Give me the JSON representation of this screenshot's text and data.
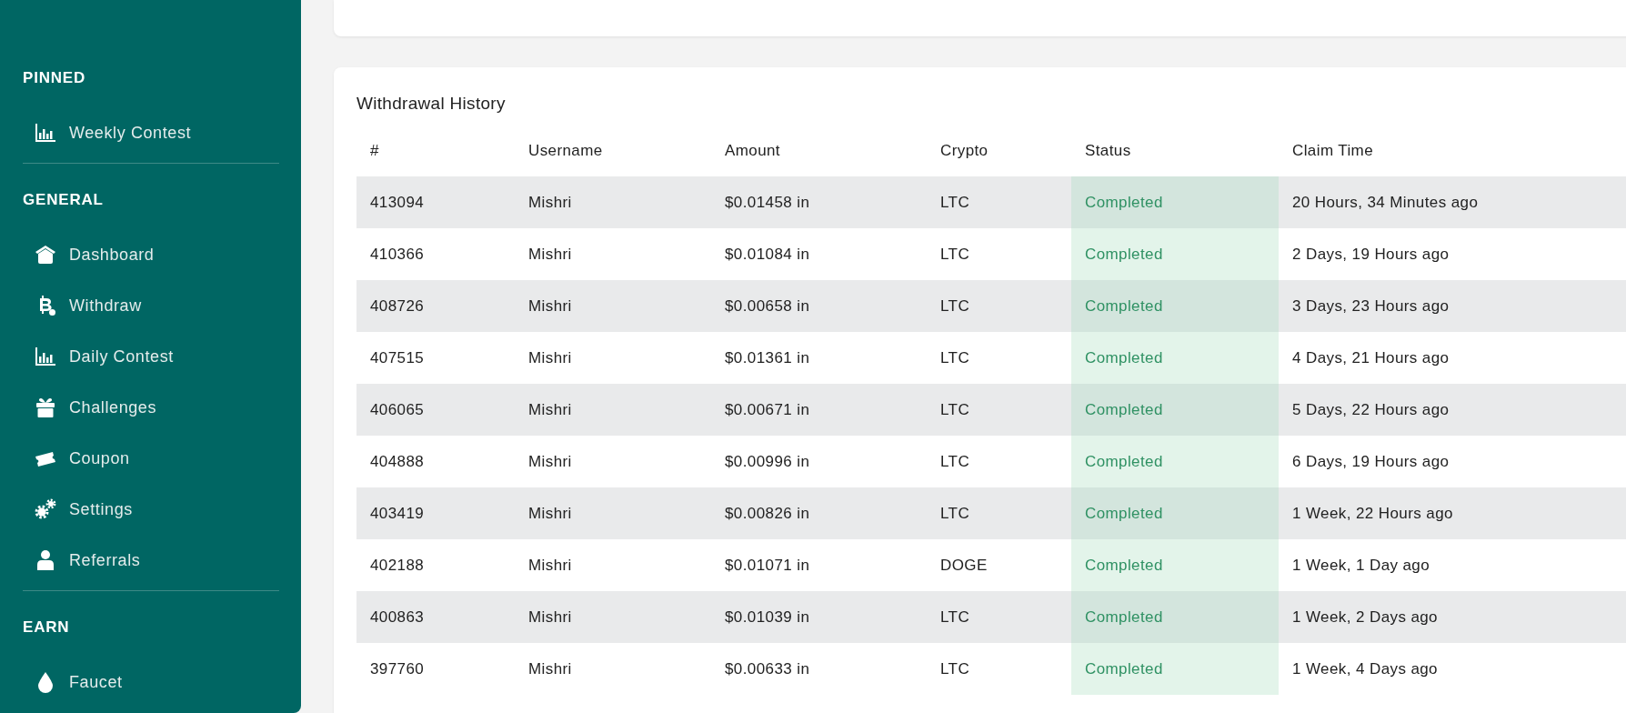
{
  "sidebar": {
    "sections": [
      {
        "heading": "PINNED",
        "items": [
          {
            "label": "Weekly Contest",
            "kind": "chart"
          }
        ]
      },
      {
        "heading": "GENERAL",
        "items": [
          {
            "label": "Dashboard",
            "kind": "home"
          },
          {
            "label": "Withdraw",
            "kind": "bitcoin"
          },
          {
            "label": "Daily Contest",
            "kind": "chart"
          },
          {
            "label": "Challenges",
            "kind": "gift"
          },
          {
            "label": "Coupon",
            "kind": "ticket"
          },
          {
            "label": "Settings",
            "kind": "gears"
          },
          {
            "label": "Referrals",
            "kind": "user"
          }
        ]
      },
      {
        "heading": "EARN",
        "items": [
          {
            "label": "Faucet",
            "kind": "drop"
          }
        ]
      }
    ]
  },
  "withdrawal_history": {
    "title": "Withdrawal History",
    "columns": [
      "#",
      "Username",
      "Amount",
      "Crypto",
      "Status",
      "Claim Time"
    ],
    "rows": [
      [
        "413094",
        "Mishri",
        "$0.01458 in",
        "LTC",
        "Completed",
        "20 Hours, 34 Minutes ago"
      ],
      [
        "410366",
        "Mishri",
        "$0.01084 in",
        "LTC",
        "Completed",
        "2 Days, 19 Hours ago"
      ],
      [
        "408726",
        "Mishri",
        "$0.00658 in",
        "LTC",
        "Completed",
        "3 Days, 23 Hours ago"
      ],
      [
        "407515",
        "Mishri",
        "$0.01361 in",
        "LTC",
        "Completed",
        "4 Days, 21 Hours ago"
      ],
      [
        "406065",
        "Mishri",
        "$0.00671 in",
        "LTC",
        "Completed",
        "5 Days, 22 Hours ago"
      ],
      [
        "404888",
        "Mishri",
        "$0.00996 in",
        "LTC",
        "Completed",
        "6 Days, 19 Hours ago"
      ],
      [
        "403419",
        "Mishri",
        "$0.00826 in",
        "LTC",
        "Completed",
        "1 Week, 22 Hours ago"
      ],
      [
        "402188",
        "Mishri",
        "$0.01071 in",
        "DOGE",
        "Completed",
        "1 Week, 1 Day ago"
      ],
      [
        "400863",
        "Mishri",
        "$0.01039 in",
        "LTC",
        "Completed",
        "1 Week, 2 Days ago"
      ],
      [
        "397760",
        "Mishri",
        "$0.00633 in",
        "LTC",
        "Completed",
        "1 Week, 4 Days ago"
      ]
    ]
  }
}
